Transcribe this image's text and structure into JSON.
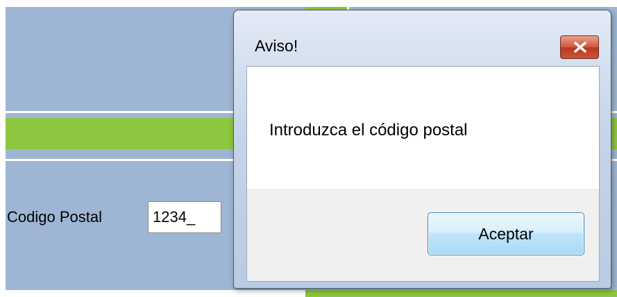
{
  "background_form": {
    "postal_code_label": "Codigo Postal",
    "postal_code_value": "1234_"
  },
  "dialog": {
    "title": "Aviso!",
    "message": "Introduzca el código postal",
    "ok_label": "Aceptar",
    "close_icon": "close-icon"
  },
  "colors": {
    "form_background": "#9eb6d4",
    "accent_green": "#8dc63f",
    "close_button_red": "#c9543a",
    "dialog_frame": "#c5d4e8"
  }
}
